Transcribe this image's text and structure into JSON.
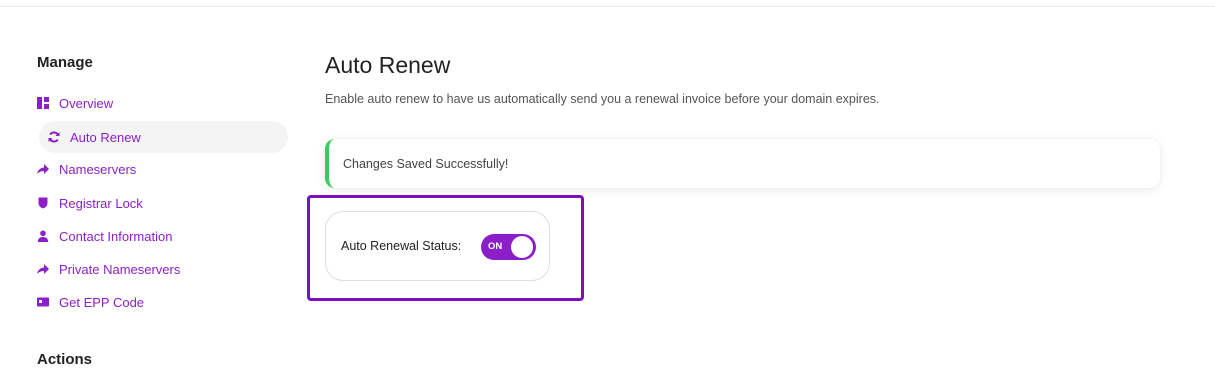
{
  "sidebar": {
    "manage_heading": "Manage",
    "actions_heading": "Actions",
    "items": [
      {
        "label": "Overview",
        "icon": "dashboard-icon"
      },
      {
        "label": "Auto Renew",
        "icon": "sync-icon",
        "active": true
      },
      {
        "label": "Nameservers",
        "icon": "share-arrow-icon"
      },
      {
        "label": "Registrar Lock",
        "icon": "shield-icon"
      },
      {
        "label": "Contact Information",
        "icon": "user-icon"
      },
      {
        "label": "Private Nameservers",
        "icon": "share-arrow-icon"
      },
      {
        "label": "Get EPP Code",
        "icon": "id-card-icon"
      }
    ]
  },
  "main": {
    "title": "Auto Renew",
    "description": "Enable auto renew to have us automatically send you a renewal invoice before your domain expires.",
    "alert": "Changes Saved Successfully!",
    "status_label": "Auto Renewal Status:",
    "toggle_label": "ON",
    "toggle_on": true
  },
  "colors": {
    "accent": "#8c1ec9",
    "link": "#8b1fc9",
    "success": "#3ccb5a",
    "highlight": "#7a0fc0"
  }
}
